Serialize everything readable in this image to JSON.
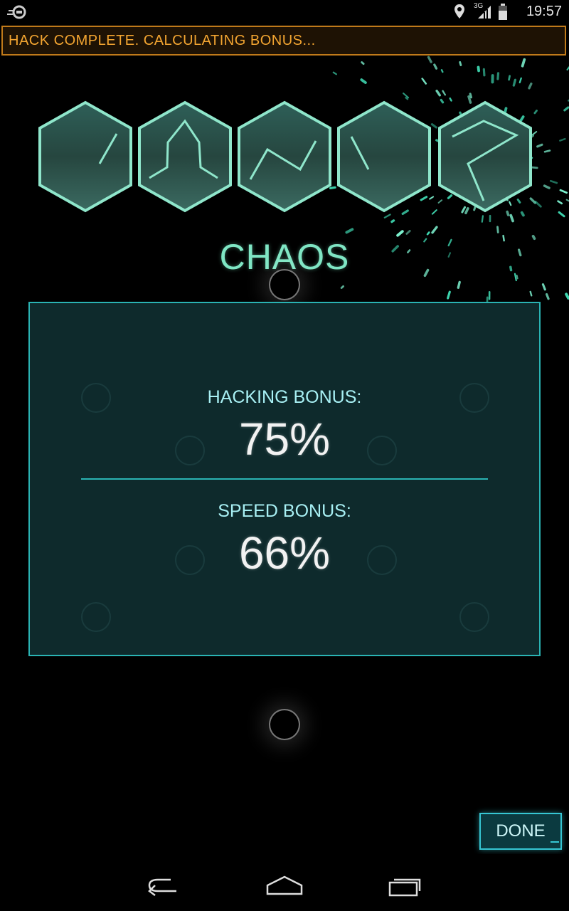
{
  "status_bar": {
    "time": "19:57",
    "network": "3G",
    "icons": [
      "location-icon",
      "signal-icon",
      "battery-icon"
    ]
  },
  "banner": {
    "text": "HACK COMPLETE. CALCULATING BONUS..."
  },
  "glyph_sequence": {
    "count": 5
  },
  "title": "CHAOS",
  "bonus_panel": {
    "hacking_label": "HACKING BONUS:",
    "hacking_value": "75%",
    "speed_label": "SPEED BONUS:",
    "speed_value": "66%"
  },
  "done_button": {
    "label": "DONE"
  },
  "nav": {
    "back": "back-icon",
    "home": "home-icon",
    "recents": "recents-icon"
  },
  "colors": {
    "accent": "#2ab3b3",
    "glyph": "#7fe6c4",
    "banner_text": "#f3a531",
    "banner_border": "#c07a1a",
    "panel_bg": "#0e2a2c"
  }
}
